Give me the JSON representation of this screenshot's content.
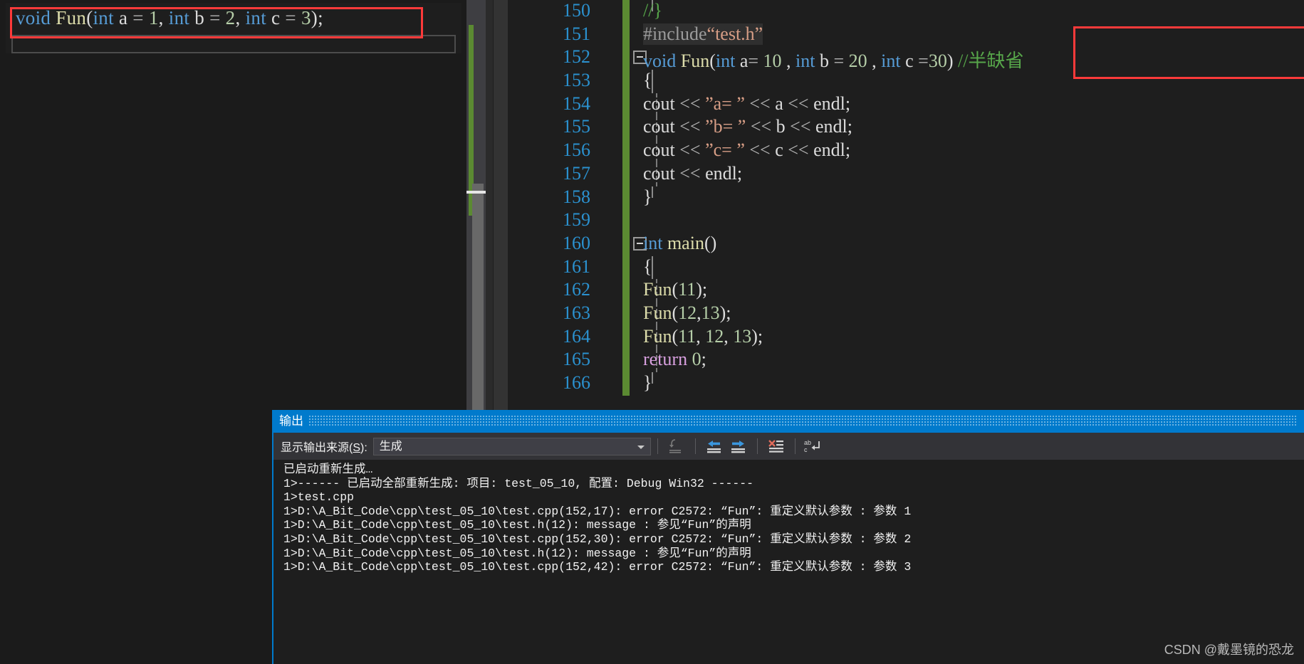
{
  "popup": {
    "name": "quick-info-popup",
    "tokens": [
      {
        "t": "void",
        "c": "kw"
      },
      {
        "t": " ",
        "c": "id"
      },
      {
        "t": "Fun",
        "c": "fn"
      },
      {
        "t": "(",
        "c": "punc"
      },
      {
        "t": "int",
        "c": "kw"
      },
      {
        "t": " a ",
        "c": "id"
      },
      {
        "t": "= ",
        "c": "op"
      },
      {
        "t": "1",
        "c": "num"
      },
      {
        "t": ",  ",
        "c": "punc"
      },
      {
        "t": "int",
        "c": "kw"
      },
      {
        "t": " b ",
        "c": "id"
      },
      {
        "t": "= ",
        "c": "op"
      },
      {
        "t": "2",
        "c": "num"
      },
      {
        "t": ",  ",
        "c": "punc"
      },
      {
        "t": "int",
        "c": "kw"
      },
      {
        "t": " c ",
        "c": "id"
      },
      {
        "t": "= ",
        "c": "op"
      },
      {
        "t": "3",
        "c": "num"
      },
      {
        "t": ")",
        "c": "punc"
      },
      {
        "t": ";",
        "c": "punc"
      }
    ],
    "plain": "void Fun(int a = 1,  int b = 2,  int c = 3);"
  },
  "editor": {
    "first_visible_line_partial": "149",
    "lines": [
      {
        "num": "150",
        "fold": false,
        "guide": "corner",
        "tokens": [
          {
            "t": "    //}",
            "c": "cmt"
          }
        ]
      },
      {
        "num": "151",
        "fold": false,
        "guide": "none",
        "highlighted": true,
        "tokens": [
          {
            "t": "  #include",
            "c": "pp"
          },
          {
            "t": "“test.h”",
            "c": "str"
          }
        ]
      },
      {
        "num": "152",
        "fold": true,
        "guide": "none",
        "tokens": [
          {
            "t": "  void",
            "c": "kw"
          },
          {
            "t": " ",
            "c": "id"
          },
          {
            "t": "Fun",
            "c": "fn"
          },
          {
            "t": "(",
            "c": "punc"
          },
          {
            "t": "int",
            "c": "kw"
          },
          {
            "t": " a",
            "c": "id"
          },
          {
            "t": "= ",
            "c": "op"
          },
          {
            "t": "10",
            "c": "num"
          },
          {
            "t": " ,  ",
            "c": "punc"
          },
          {
            "t": "int",
            "c": "kw"
          },
          {
            "t": " b ",
            "c": "id"
          },
          {
            "t": "= ",
            "c": "op"
          },
          {
            "t": "20",
            "c": "num"
          },
          {
            "t": " ,  ",
            "c": "punc"
          },
          {
            "t": "int",
            "c": "kw"
          },
          {
            "t": " c ",
            "c": "id"
          },
          {
            "t": "=",
            "c": "op"
          },
          {
            "t": "30",
            "c": "num"
          },
          {
            "t": ")",
            "c": "punc"
          },
          {
            "t": "  //半缺省",
            "c": "cmt"
          }
        ]
      },
      {
        "num": "153",
        "fold": false,
        "guide": "vline",
        "tokens": [
          {
            "t": "  {",
            "c": "punc"
          }
        ]
      },
      {
        "num": "154",
        "fold": false,
        "guide": "dash",
        "tokens": [
          {
            "t": "      cout",
            "c": "id"
          },
          {
            "t": " << ",
            "c": "op"
          },
          {
            "t": "”a= ”",
            "c": "str"
          },
          {
            "t": " << ",
            "c": "op"
          },
          {
            "t": "a",
            "c": "id"
          },
          {
            "t": " << ",
            "c": "op"
          },
          {
            "t": "endl",
            "c": "id"
          },
          {
            "t": ";",
            "c": "punc"
          }
        ]
      },
      {
        "num": "155",
        "fold": false,
        "guide": "dash",
        "tokens": [
          {
            "t": "      cout",
            "c": "id"
          },
          {
            "t": " << ",
            "c": "op"
          },
          {
            "t": "”b= ”",
            "c": "str"
          },
          {
            "t": " << ",
            "c": "op"
          },
          {
            "t": "b",
            "c": "id"
          },
          {
            "t": " << ",
            "c": "op"
          },
          {
            "t": "endl",
            "c": "id"
          },
          {
            "t": ";",
            "c": "punc"
          }
        ]
      },
      {
        "num": "156",
        "fold": false,
        "guide": "dash",
        "tokens": [
          {
            "t": "      cout",
            "c": "id"
          },
          {
            "t": " << ",
            "c": "op"
          },
          {
            "t": "”c= ”",
            "c": "str"
          },
          {
            "t": " << ",
            "c": "op"
          },
          {
            "t": "c",
            "c": "id"
          },
          {
            "t": " << ",
            "c": "op"
          },
          {
            "t": "endl",
            "c": "id"
          },
          {
            "t": ";",
            "c": "punc"
          }
        ]
      },
      {
        "num": "157",
        "fold": false,
        "guide": "dash",
        "tokens": [
          {
            "t": "      cout",
            "c": "id"
          },
          {
            "t": " << ",
            "c": "op"
          },
          {
            "t": "endl",
            "c": "id"
          },
          {
            "t": ";",
            "c": "punc"
          }
        ]
      },
      {
        "num": "158",
        "fold": false,
        "guide": "corner",
        "tokens": [
          {
            "t": "  }",
            "c": "punc"
          }
        ]
      },
      {
        "num": "159",
        "fold": false,
        "guide": "none",
        "tokens": [
          {
            "t": "",
            "c": "id"
          }
        ]
      },
      {
        "num": "160",
        "fold": true,
        "guide": "none",
        "tokens": [
          {
            "t": "  int",
            "c": "kw"
          },
          {
            "t": " ",
            "c": "id"
          },
          {
            "t": "main",
            "c": "fn"
          },
          {
            "t": "()",
            "c": "punc"
          }
        ]
      },
      {
        "num": "161",
        "fold": false,
        "guide": "vline",
        "tokens": [
          {
            "t": "  {",
            "c": "punc"
          }
        ]
      },
      {
        "num": "162",
        "fold": false,
        "guide": "dash",
        "tokens": [
          {
            "t": "      ",
            "c": "id"
          },
          {
            "t": "Fun",
            "c": "fn"
          },
          {
            "t": "(",
            "c": "punc"
          },
          {
            "t": "11",
            "c": "num"
          },
          {
            "t": ");",
            "c": "punc"
          }
        ]
      },
      {
        "num": "163",
        "fold": false,
        "guide": "dash",
        "tokens": [
          {
            "t": "      ",
            "c": "id"
          },
          {
            "t": "Fun",
            "c": "fn"
          },
          {
            "t": "(",
            "c": "punc"
          },
          {
            "t": "12",
            "c": "num"
          },
          {
            "t": ",",
            "c": "punc"
          },
          {
            "t": "13",
            "c": "num"
          },
          {
            "t": ");",
            "c": "punc"
          }
        ]
      },
      {
        "num": "164",
        "fold": false,
        "guide": "dash",
        "tokens": [
          {
            "t": "      ",
            "c": "id"
          },
          {
            "t": "Fun",
            "c": "fn"
          },
          {
            "t": "(",
            "c": "punc"
          },
          {
            "t": "11",
            "c": "num"
          },
          {
            "t": ",  ",
            "c": "punc"
          },
          {
            "t": "12",
            "c": "num"
          },
          {
            "t": ",  ",
            "c": "punc"
          },
          {
            "t": "13",
            "c": "num"
          },
          {
            "t": ");",
            "c": "punc"
          }
        ]
      },
      {
        "num": "165",
        "fold": false,
        "guide": "dash",
        "tokens": [
          {
            "t": "      ",
            "c": "id"
          },
          {
            "t": "return",
            "c": "ret"
          },
          {
            "t": " ",
            "c": "id"
          },
          {
            "t": "0",
            "c": "num"
          },
          {
            "t": ";",
            "c": "punc"
          }
        ]
      },
      {
        "num": "166",
        "fold": false,
        "guide": "corner",
        "tokens": [
          {
            "t": "  }",
            "c": "punc"
          }
        ]
      }
    ]
  },
  "output_window": {
    "title": "输出",
    "source_label": "显示输出来源(S):",
    "source_label_prefix": "显示输出来源(",
    "source_label_accel": "S",
    "source_label_suffix": "):",
    "selected_source": "生成",
    "toolbar_buttons": [
      {
        "name": "goto-message-icon",
        "glyph": "↵≡",
        "enabled": false
      },
      {
        "name": "previous-message-icon",
        "glyph": "←≡",
        "enabled": true
      },
      {
        "name": "next-message-icon",
        "glyph": "→≡",
        "enabled": true
      },
      {
        "name": "clear-all-icon",
        "glyph": "✕≡",
        "enabled": true
      },
      {
        "name": "toggle-word-wrap-icon",
        "glyph": "abc↵",
        "enabled": true
      }
    ],
    "lines": [
      "已启动重新生成…",
      "1>------ 已启动全部重新生成: 项目: test_05_10, 配置: Debug Win32 ------",
      "1>test.cpp",
      "1>D:\\A_Bit_Code\\cpp\\test_05_10\\test.cpp(152,17): error C2572: “Fun”: 重定义默认参数 : 参数 1",
      "1>D:\\A_Bit_Code\\cpp\\test_05_10\\test.h(12): message : 参见“Fun”的声明",
      "1>D:\\A_Bit_Code\\cpp\\test_05_10\\test.cpp(152,30): error C2572: “Fun”: 重定义默认参数 : 参数 2",
      "1>D:\\A_Bit_Code\\cpp\\test_05_10\\test.h(12): message : 参见“Fun”的声明",
      "1>D:\\A_Bit_Code\\cpp\\test_05_10\\test.cpp(152,42): error C2572: “Fun”: 重定义默认参数 : 参数 3"
    ]
  },
  "watermark": "CSDN @戴墨镜的恐龙",
  "colors": {
    "accent_blue": "#007acc",
    "highlight_red": "#fd3a3a",
    "change_bar_green": "#5b8a32",
    "line_number_blue": "#2b91cf",
    "editor_bg": "#1e1e1e",
    "toolbar_bg": "#333337"
  }
}
